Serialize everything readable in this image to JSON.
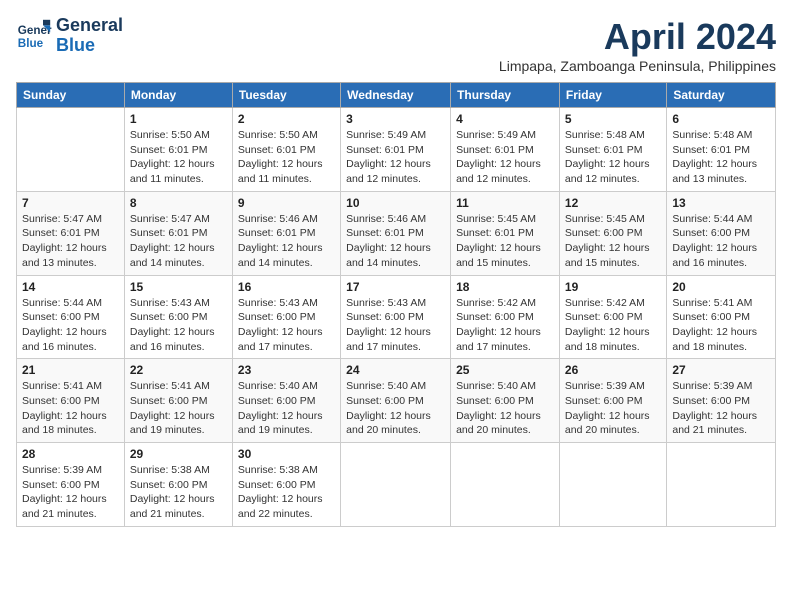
{
  "header": {
    "logo_line1": "General",
    "logo_line2": "Blue",
    "month": "April 2024",
    "location": "Limpapa, Zamboanga Peninsula, Philippines"
  },
  "days_of_week": [
    "Sunday",
    "Monday",
    "Tuesday",
    "Wednesday",
    "Thursday",
    "Friday",
    "Saturday"
  ],
  "weeks": [
    [
      {
        "day": "",
        "info": ""
      },
      {
        "day": "1",
        "info": "Sunrise: 5:50 AM\nSunset: 6:01 PM\nDaylight: 12 hours\nand 11 minutes."
      },
      {
        "day": "2",
        "info": "Sunrise: 5:50 AM\nSunset: 6:01 PM\nDaylight: 12 hours\nand 11 minutes."
      },
      {
        "day": "3",
        "info": "Sunrise: 5:49 AM\nSunset: 6:01 PM\nDaylight: 12 hours\nand 12 minutes."
      },
      {
        "day": "4",
        "info": "Sunrise: 5:49 AM\nSunset: 6:01 PM\nDaylight: 12 hours\nand 12 minutes."
      },
      {
        "day": "5",
        "info": "Sunrise: 5:48 AM\nSunset: 6:01 PM\nDaylight: 12 hours\nand 12 minutes."
      },
      {
        "day": "6",
        "info": "Sunrise: 5:48 AM\nSunset: 6:01 PM\nDaylight: 12 hours\nand 13 minutes."
      }
    ],
    [
      {
        "day": "7",
        "info": "Sunrise: 5:47 AM\nSunset: 6:01 PM\nDaylight: 12 hours\nand 13 minutes."
      },
      {
        "day": "8",
        "info": "Sunrise: 5:47 AM\nSunset: 6:01 PM\nDaylight: 12 hours\nand 14 minutes."
      },
      {
        "day": "9",
        "info": "Sunrise: 5:46 AM\nSunset: 6:01 PM\nDaylight: 12 hours\nand 14 minutes."
      },
      {
        "day": "10",
        "info": "Sunrise: 5:46 AM\nSunset: 6:01 PM\nDaylight: 12 hours\nand 14 minutes."
      },
      {
        "day": "11",
        "info": "Sunrise: 5:45 AM\nSunset: 6:01 PM\nDaylight: 12 hours\nand 15 minutes."
      },
      {
        "day": "12",
        "info": "Sunrise: 5:45 AM\nSunset: 6:00 PM\nDaylight: 12 hours\nand 15 minutes."
      },
      {
        "day": "13",
        "info": "Sunrise: 5:44 AM\nSunset: 6:00 PM\nDaylight: 12 hours\nand 16 minutes."
      }
    ],
    [
      {
        "day": "14",
        "info": "Sunrise: 5:44 AM\nSunset: 6:00 PM\nDaylight: 12 hours\nand 16 minutes."
      },
      {
        "day": "15",
        "info": "Sunrise: 5:43 AM\nSunset: 6:00 PM\nDaylight: 12 hours\nand 16 minutes."
      },
      {
        "day": "16",
        "info": "Sunrise: 5:43 AM\nSunset: 6:00 PM\nDaylight: 12 hours\nand 17 minutes."
      },
      {
        "day": "17",
        "info": "Sunrise: 5:43 AM\nSunset: 6:00 PM\nDaylight: 12 hours\nand 17 minutes."
      },
      {
        "day": "18",
        "info": "Sunrise: 5:42 AM\nSunset: 6:00 PM\nDaylight: 12 hours\nand 17 minutes."
      },
      {
        "day": "19",
        "info": "Sunrise: 5:42 AM\nSunset: 6:00 PM\nDaylight: 12 hours\nand 18 minutes."
      },
      {
        "day": "20",
        "info": "Sunrise: 5:41 AM\nSunset: 6:00 PM\nDaylight: 12 hours\nand 18 minutes."
      }
    ],
    [
      {
        "day": "21",
        "info": "Sunrise: 5:41 AM\nSunset: 6:00 PM\nDaylight: 12 hours\nand 18 minutes."
      },
      {
        "day": "22",
        "info": "Sunrise: 5:41 AM\nSunset: 6:00 PM\nDaylight: 12 hours\nand 19 minutes."
      },
      {
        "day": "23",
        "info": "Sunrise: 5:40 AM\nSunset: 6:00 PM\nDaylight: 12 hours\nand 19 minutes."
      },
      {
        "day": "24",
        "info": "Sunrise: 5:40 AM\nSunset: 6:00 PM\nDaylight: 12 hours\nand 20 minutes."
      },
      {
        "day": "25",
        "info": "Sunrise: 5:40 AM\nSunset: 6:00 PM\nDaylight: 12 hours\nand 20 minutes."
      },
      {
        "day": "26",
        "info": "Sunrise: 5:39 AM\nSunset: 6:00 PM\nDaylight: 12 hours\nand 20 minutes."
      },
      {
        "day": "27",
        "info": "Sunrise: 5:39 AM\nSunset: 6:00 PM\nDaylight: 12 hours\nand 21 minutes."
      }
    ],
    [
      {
        "day": "28",
        "info": "Sunrise: 5:39 AM\nSunset: 6:00 PM\nDaylight: 12 hours\nand 21 minutes."
      },
      {
        "day": "29",
        "info": "Sunrise: 5:38 AM\nSunset: 6:00 PM\nDaylight: 12 hours\nand 21 minutes."
      },
      {
        "day": "30",
        "info": "Sunrise: 5:38 AM\nSunset: 6:00 PM\nDaylight: 12 hours\nand 22 minutes."
      },
      {
        "day": "",
        "info": ""
      },
      {
        "day": "",
        "info": ""
      },
      {
        "day": "",
        "info": ""
      },
      {
        "day": "",
        "info": ""
      }
    ]
  ]
}
